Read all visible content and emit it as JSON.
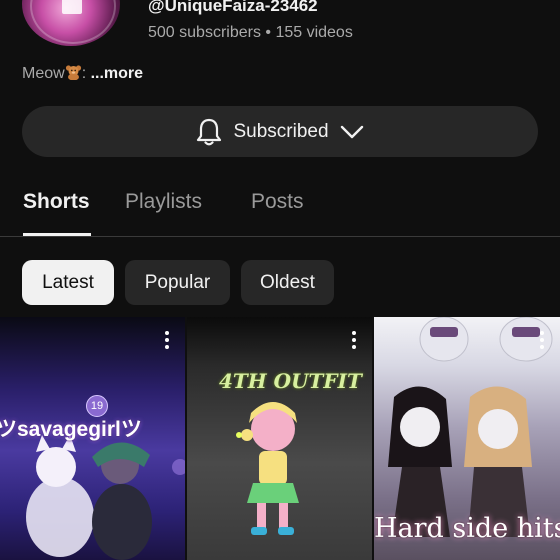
{
  "channel": {
    "handle": "@UniqueFaiza-23462",
    "stats": "500 subscribers • 155 videos",
    "description": "Meow",
    "description_separator": ":",
    "more_label": "...more",
    "avatar_icon": "channel-avatar",
    "description_icon": "teddy-bear-emoji"
  },
  "subscribe": {
    "label": "Subscribed",
    "icons": [
      "bell-icon",
      "chevron-down-icon"
    ]
  },
  "tabs": [
    {
      "label": "Shorts",
      "active": true
    },
    {
      "label": "Playlists",
      "active": false
    },
    {
      "label": "Posts",
      "active": false
    }
  ],
  "filters": [
    {
      "label": "Latest",
      "active": true
    },
    {
      "label": "Popular",
      "active": false
    },
    {
      "label": "Oldest",
      "active": false
    }
  ],
  "shorts": [
    {
      "caption": "ツsavagegirlツ",
      "badge": "19"
    },
    {
      "caption": "4TH OUTFIT"
    },
    {
      "caption": "Hard side hits"
    }
  ],
  "colors": {
    "background": "#0f0f0f",
    "button": "#272727",
    "active_chip": "#f1f1f1",
    "secondary_text": "#aaaaaa"
  }
}
